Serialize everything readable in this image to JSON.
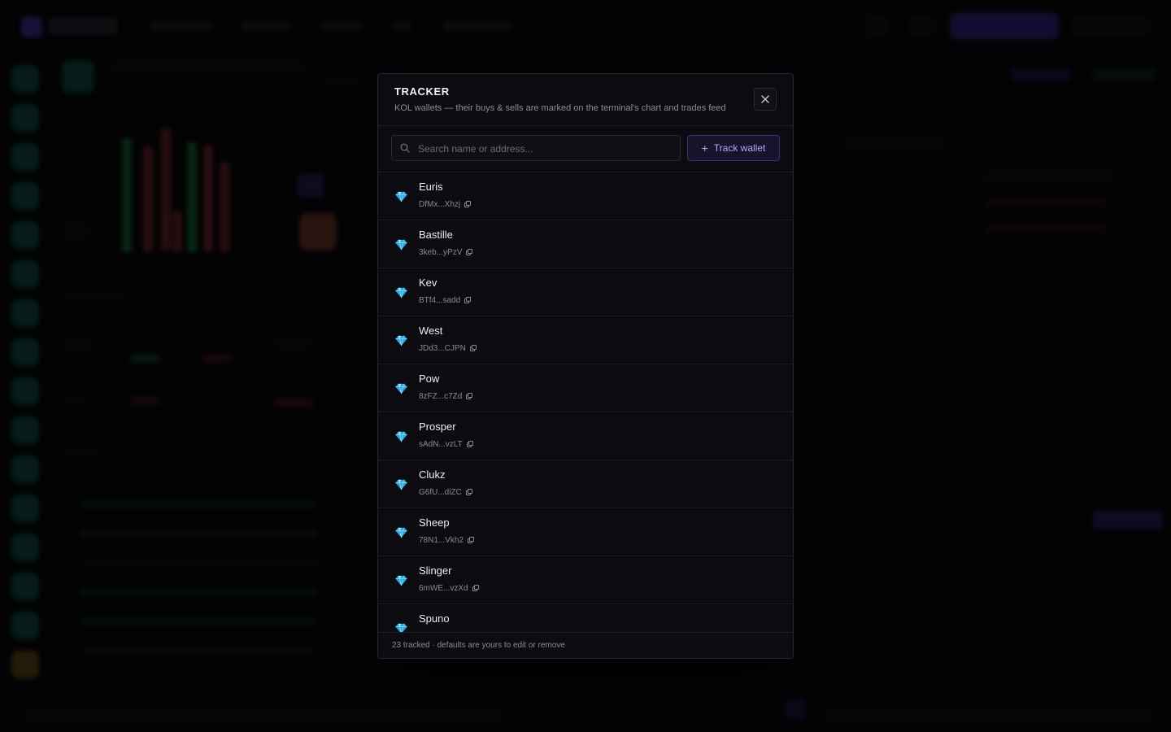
{
  "modal": {
    "title": "TRACKER",
    "subtitle": "KOL wallets — their buys & sells are marked on the terminal's chart and trades feed",
    "close_icon": "close-icon",
    "search": {
      "placeholder": "Search name or address..."
    },
    "track_button": {
      "label": "Track wallet",
      "icon": "plus-icon"
    },
    "wallets": [
      {
        "name": "Euris",
        "address": "DfMx...Xhzj",
        "icon": "gem-icon"
      },
      {
        "name": "Bastille",
        "address": "3keb...yPzV",
        "icon": "gem-icon"
      },
      {
        "name": "Kev",
        "address": "BTf4...sadd",
        "icon": "gem-icon"
      },
      {
        "name": "West",
        "address": "JDd3...CJPN",
        "icon": "gem-icon"
      },
      {
        "name": "Pow",
        "address": "8zFZ...c7Zd",
        "icon": "gem-icon"
      },
      {
        "name": "Prosper",
        "address": "sAdN...vzLT",
        "icon": "gem-icon"
      },
      {
        "name": "Clukz",
        "address": "G6fU...diZC",
        "icon": "gem-icon"
      },
      {
        "name": "Sheep",
        "address": "78N1...Vkh2",
        "icon": "gem-icon"
      },
      {
        "name": "Slinger",
        "address": "6mWE...vzXd",
        "icon": "gem-icon"
      },
      {
        "name": "Spuno",
        "address": "",
        "icon": "gem-icon"
      }
    ],
    "footer": "23 tracked · defaults are yours to edit or remove"
  },
  "colors": {
    "accent": "#b8a8ff",
    "gem": "#4fc3f7",
    "background": "#0c0c10"
  }
}
